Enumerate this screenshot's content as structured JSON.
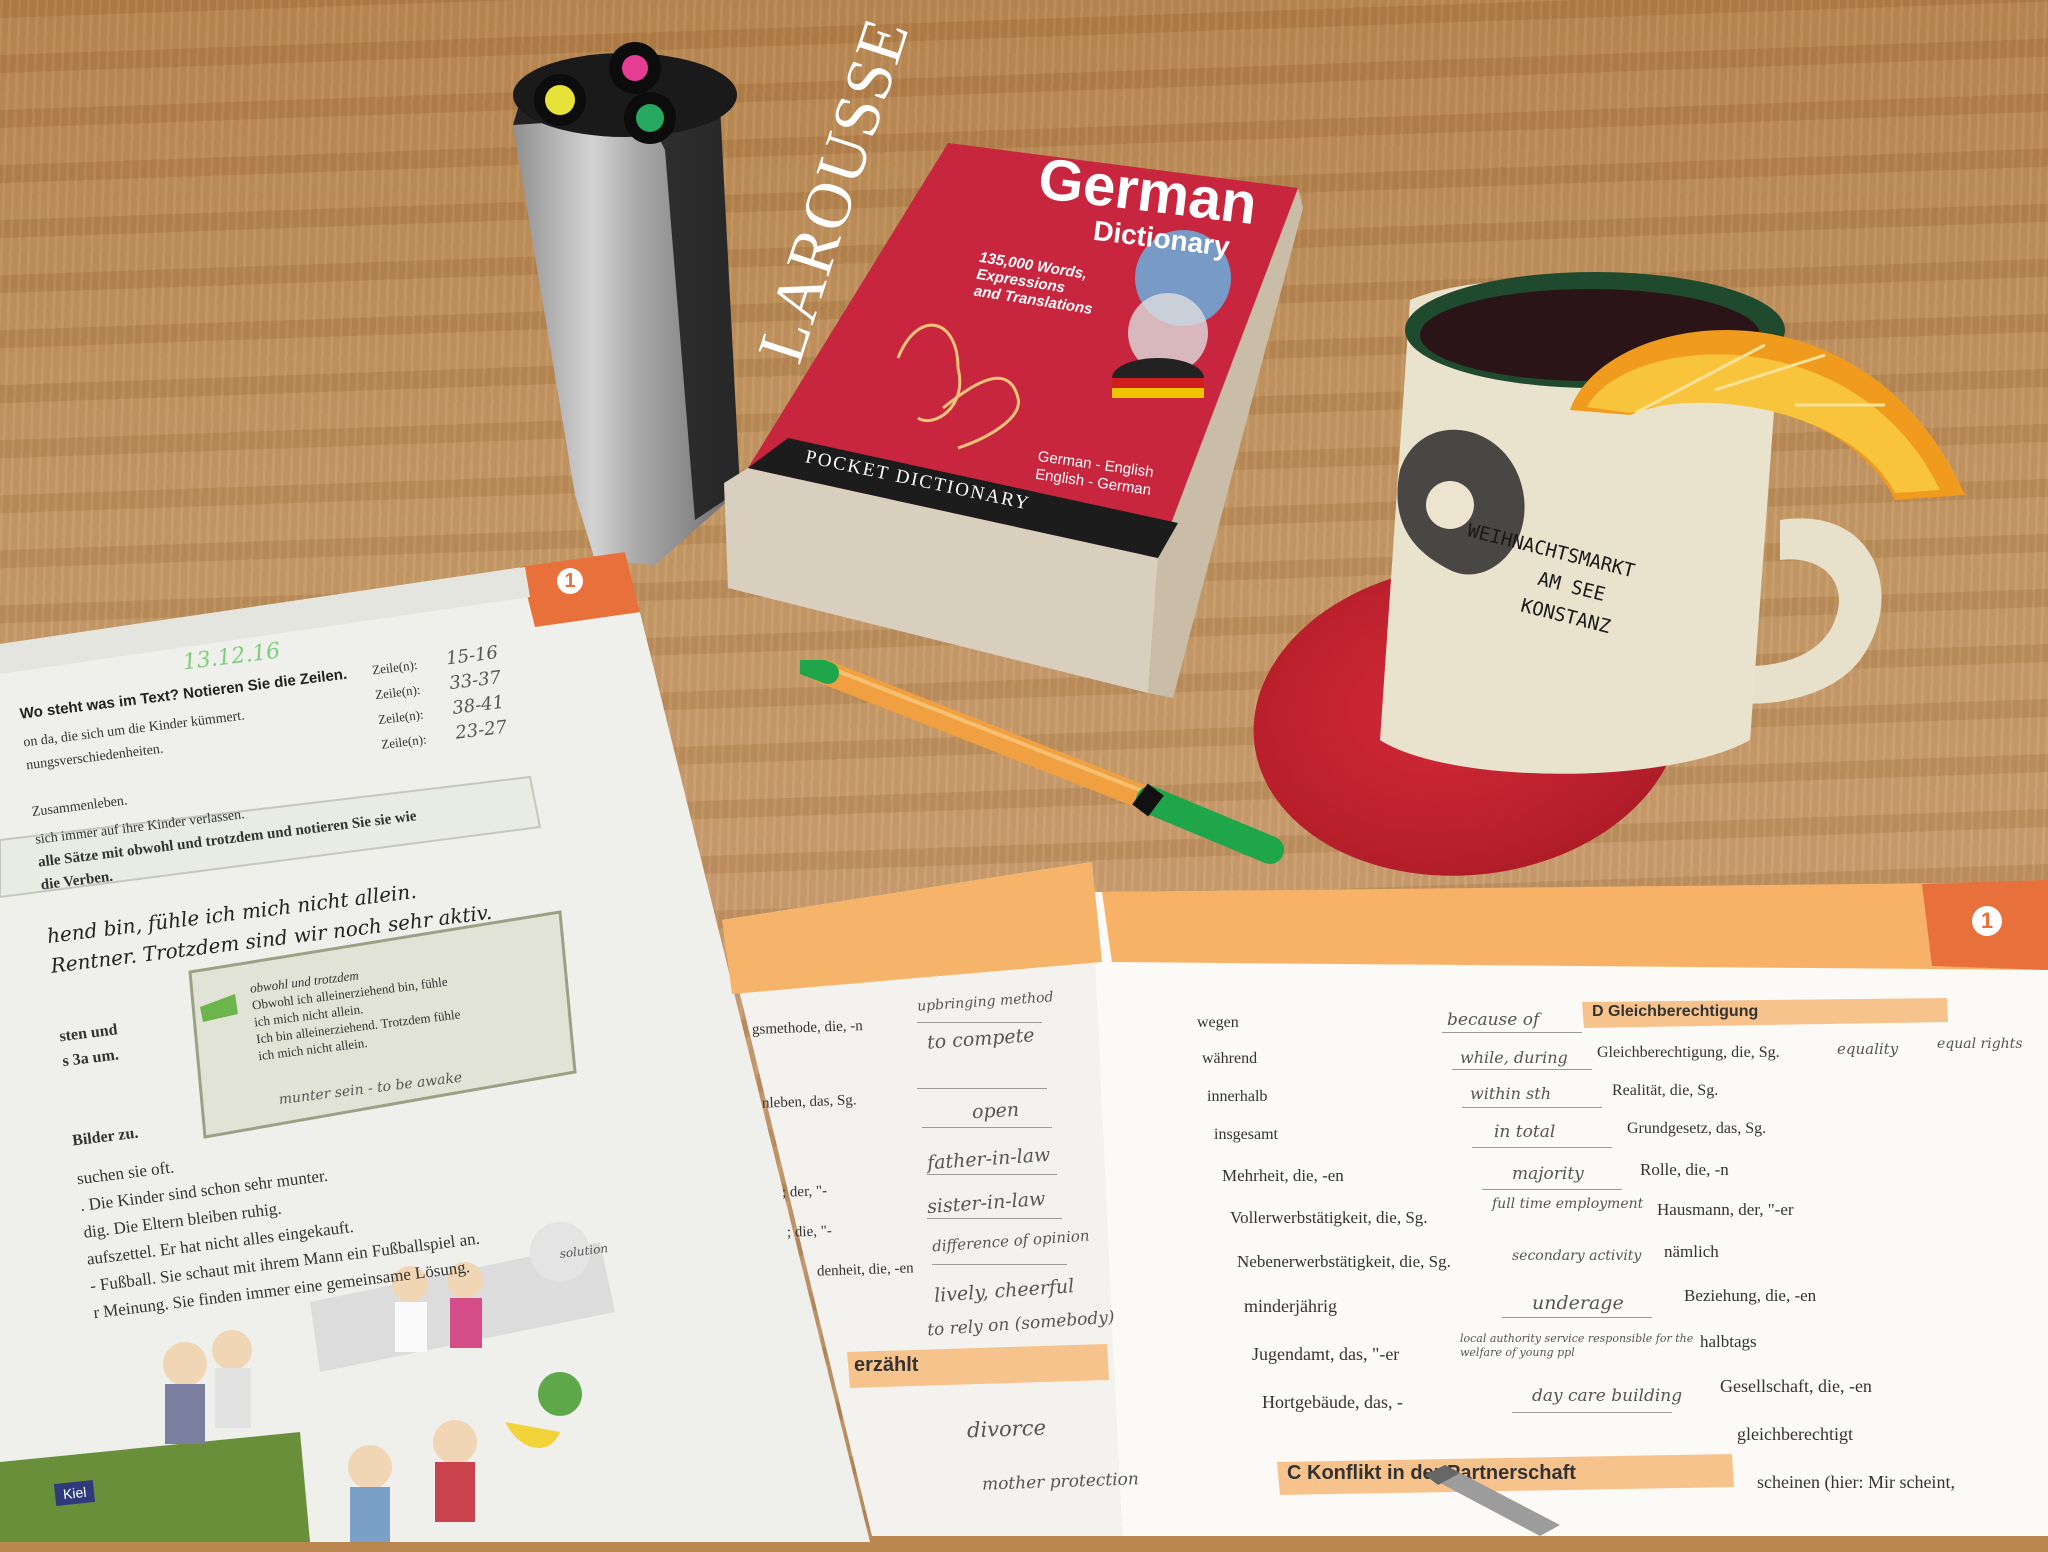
{
  "dictionary": {
    "brand": "LAROUSSE",
    "title": "German",
    "subtitle": "Dictionary",
    "blurb_lines": [
      "135,000 Words,",
      "Expressions",
      "and Translations"
    ],
    "languages": [
      "German - English",
      "English - German"
    ],
    "spine_label": "POCKET DICTIONARY"
  },
  "mug": {
    "lines": [
      "WEIHNACHTSMARKT",
      "AM SEE",
      "KONSTANZ"
    ]
  },
  "left_book": {
    "page_number": "1",
    "date": "13.12.16",
    "task_a": "Wo steht was im Text? Notieren Sie die Zeilen.",
    "statements": [
      "on da, die sich um die Kinder kümmert.",
      "nungsverschiedenheiten.",
      "Zusammenleben.",
      "sich immer auf ihre Kinder verlassen."
    ],
    "zeile_label": "Zeile(n):",
    "zeile_answers": [
      "15-16",
      "33-37",
      "38-41",
      "23-27"
    ],
    "task_b_line1": "alle Sätze mit obwohl und trotzdem und notieren Sie sie wie",
    "task_b_line2": "die Verben.",
    "hw_line1": "hend bin, fühle ich mich nicht allein.",
    "hw_line2": "Rentner. Trotzdem sind wir noch sehr aktiv.",
    "grammar_box": [
      "obwohl und trotzdem",
      "Obwohl ich alleinerziehend bin, fühle",
      "ich mich nicht allein.",
      "Ich bin alleinerziehend. Trotzdem fühle",
      "ich mich nicht allein."
    ],
    "note_above": "munter sein - to be awake",
    "side_text": [
      "sten und",
      "s 3a um."
    ],
    "task_c": "Bilder zu.",
    "story_lines": [
      "suchen sie oft.",
      ". Die Kinder sind schon sehr munter.",
      "dig. Die Eltern bleiben ruhig.",
      "aufszettel. Er hat nicht alles eingekauft.",
      "- Fußball. Sie schaut mit ihrem Mann ein Fußballspiel an.",
      "r Meinung. Sie finden immer eine gemeinsame Lösung."
    ],
    "note_solution": "solution",
    "badge": "Kiel"
  },
  "right_book": {
    "page_number": "1",
    "left_column": {
      "terms": [
        "gsmethode, die, -n",
        "nleben, das, Sg.",
        "; der, \"-",
        "; die, \"-",
        "denheit, die, -en"
      ],
      "answers": [
        "upbringing method",
        "to compete",
        "open",
        "father-in-law",
        "sister-in-law",
        "difference of opinion",
        "lively, cheerful",
        "to rely on (somebody)"
      ],
      "section": "erzählt",
      "answers_after": [
        "divorce",
        "mother protection"
      ]
    },
    "middle_column": {
      "terms": [
        "wegen",
        "während",
        "innerhalb",
        "insgesamt",
        "Mehrheit, die, -en",
        "Vollerwerbstätigkeit, die, Sg.",
        "Nebenerwerbstätigkeit, die, Sg.",
        "minderjährig",
        "Jugendamt, das, \"-er",
        "Hortgebäude, das, -"
      ],
      "answers": [
        "because of",
        "while, during",
        "within sth",
        "in total",
        "majority",
        "full time employment",
        "secondary activity",
        "underage",
        "local authority service responsible for the welfare of young ppl",
        "day care building"
      ],
      "section": "C Konflikt in der Partnerschaft"
    },
    "right_column": {
      "section": "D Gleichberechtigung",
      "terms": [
        "Gleichberechtigung, die, Sg.",
        "Realität, die, Sg.",
        "Grundgesetz, das, Sg.",
        "Rolle, die, -n",
        "Hausmann, der, \"-er",
        "nämlich",
        "Beziehung, die, -en",
        "halbtags",
        "Gesellschaft, die, -en",
        "gleichberechtigt",
        "scheinen (hier: Mir scheint,"
      ],
      "answers": [
        "equality",
        "equal rights"
      ]
    }
  }
}
